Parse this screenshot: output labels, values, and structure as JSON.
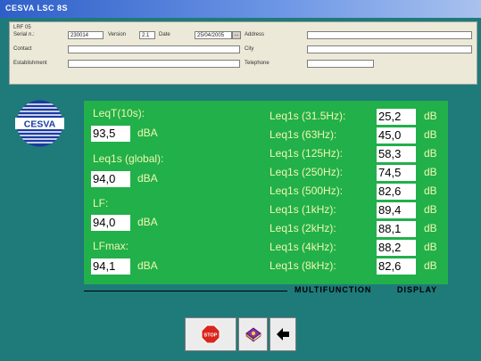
{
  "window": {
    "title": "CESVA LSC 8S"
  },
  "info": {
    "section": "LRF 05",
    "serial_label": "Serial n.:",
    "serial_value": "230014",
    "version_label": "Version",
    "version_value": "2.1",
    "date_label": "Date",
    "date_value": "25/04/2005",
    "date_button": "...",
    "address_label": "Address",
    "address_value": "",
    "contact_label": "Contact",
    "contact_value": "",
    "city_label": "City",
    "city_value": "",
    "establishment_label": "Establishment",
    "establishment_value": "",
    "telephone_label": "Telephone",
    "telephone_value": "",
    "extra_value": ""
  },
  "brand": {
    "logo_text": "CESVA"
  },
  "measurements": {
    "left": [
      {
        "label": "LeqT(10s):",
        "value": "93,5",
        "unit": "dBA"
      },
      {
        "label": "Leq1s (global):",
        "value": "94,0",
        "unit": "dBA"
      },
      {
        "label": "LF:",
        "value": "94,0",
        "unit": "dBA"
      },
      {
        "label": "LFmax:",
        "value": "94,1",
        "unit": "dBA"
      }
    ],
    "bands": [
      {
        "label": "Leq1s (31.5Hz):",
        "value": "25,2",
        "unit": "dB"
      },
      {
        "label": "Leq1s (63Hz):",
        "value": "45,0",
        "unit": "dB"
      },
      {
        "label": "Leq1s (125Hz):",
        "value": "58,3",
        "unit": "dB"
      },
      {
        "label": "Leq1s (250Hz):",
        "value": "74,5",
        "unit": "dB"
      },
      {
        "label": "Leq1s (500Hz):",
        "value": "82,6",
        "unit": "dB"
      },
      {
        "label": "Leq1s (1kHz):",
        "value": "89,4",
        "unit": "dB"
      },
      {
        "label": "Leq1s (2kHz):",
        "value": "88,1",
        "unit": "dB"
      },
      {
        "label": "Leq1s (4kHz):",
        "value": "88,2",
        "unit": "dB"
      },
      {
        "label": "Leq1s (8kHz):",
        "value": "82,6",
        "unit": "dB"
      }
    ]
  },
  "display_mode": {
    "word1": "MULTIFUNCTION",
    "word2": "DISPLAY"
  },
  "toolbar": {
    "stop_label": "STOP"
  },
  "colors": {
    "panel": "#1f7a7a",
    "display": "#21b04a",
    "label_text": "#f2f7b0",
    "stop": "#d9261c"
  },
  "icons": {
    "stop": "stop-sign-icon",
    "book": "book-icon",
    "back": "arrow-left-icon"
  }
}
